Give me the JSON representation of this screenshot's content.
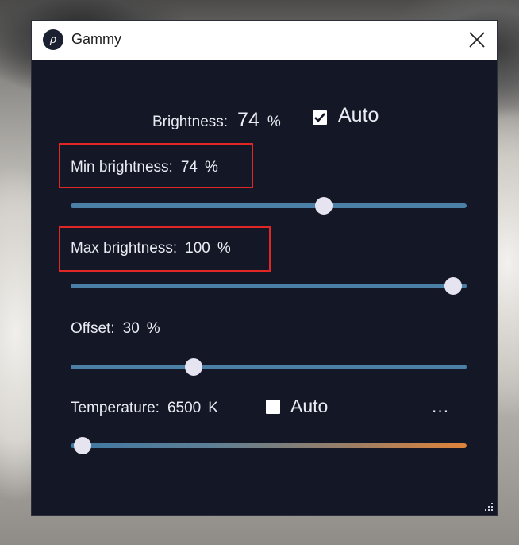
{
  "window": {
    "title": "Gammy",
    "app_icon_glyph": "ρ",
    "icon_names": [
      "gammy-app-icon",
      "close-icon",
      "resize-grip-icon",
      "checkmark-icon"
    ]
  },
  "brightness": {
    "label": "Brightness:",
    "value": "74",
    "unit": "%",
    "auto_label": "Auto",
    "auto_checked": true
  },
  "min_brightness": {
    "label": "Min brightness:",
    "value": "74",
    "unit": "%",
    "slider_fraction": 0.64
  },
  "max_brightness": {
    "label": "Max brightness:",
    "value": "100",
    "unit": "%",
    "slider_fraction": 0.965
  },
  "offset": {
    "label": "Offset:",
    "value": "30",
    "unit": "%",
    "slider_fraction": 0.31
  },
  "temperature": {
    "label": "Temperature:",
    "value": "6500",
    "unit": "K",
    "auto_label": "Auto",
    "auto_checked": false,
    "more_label": "...",
    "slider_fraction": 0.03
  },
  "colors": {
    "window_bg": "#141826",
    "track": "#4b7fa6",
    "thumb": "#e6e4f0",
    "annotation_red": "#e12626",
    "warm_end": "#e0833a"
  }
}
